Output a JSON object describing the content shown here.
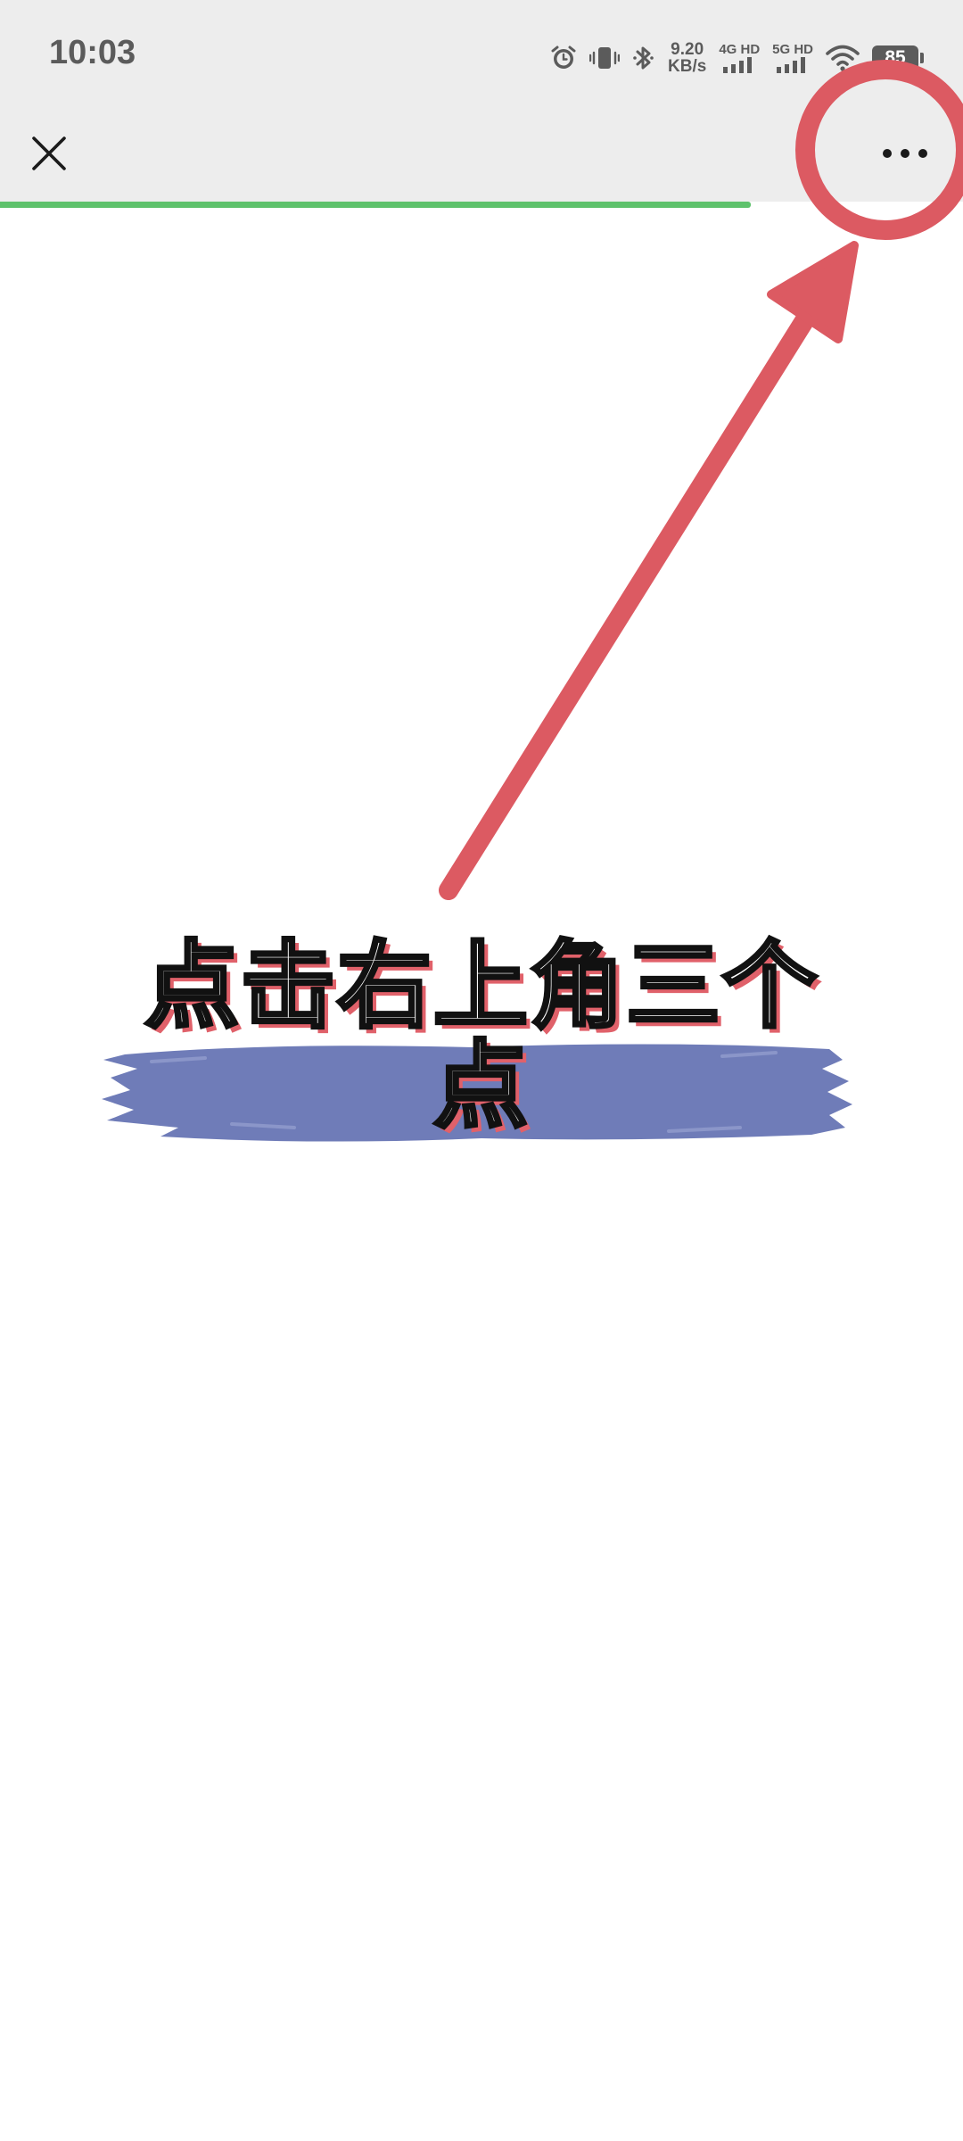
{
  "status_bar": {
    "time": "10:03",
    "net_speed_value": "9.20",
    "net_speed_unit": "KB/s",
    "sim1_label": "4G HD",
    "sim2_label": "5G HD",
    "battery_level": "85",
    "icons": [
      "alarm-icon",
      "vibrate-icon",
      "bluetooth-icon",
      "signal-icon",
      "signal-icon",
      "wifi-icon",
      "battery-icon"
    ]
  },
  "title_bar": {
    "close_icon": "close-icon",
    "more_icon": "more-horizontal-icon"
  },
  "load_progress": 0.78,
  "annotation": {
    "caption": "点击右上角三个点",
    "accent_color": "#dc5a62",
    "brush_color": "#6f7cb8"
  },
  "colors": {
    "toolbar_bg": "#ededed",
    "progress": "#5ec26c",
    "status_text": "#5b5b5b"
  }
}
